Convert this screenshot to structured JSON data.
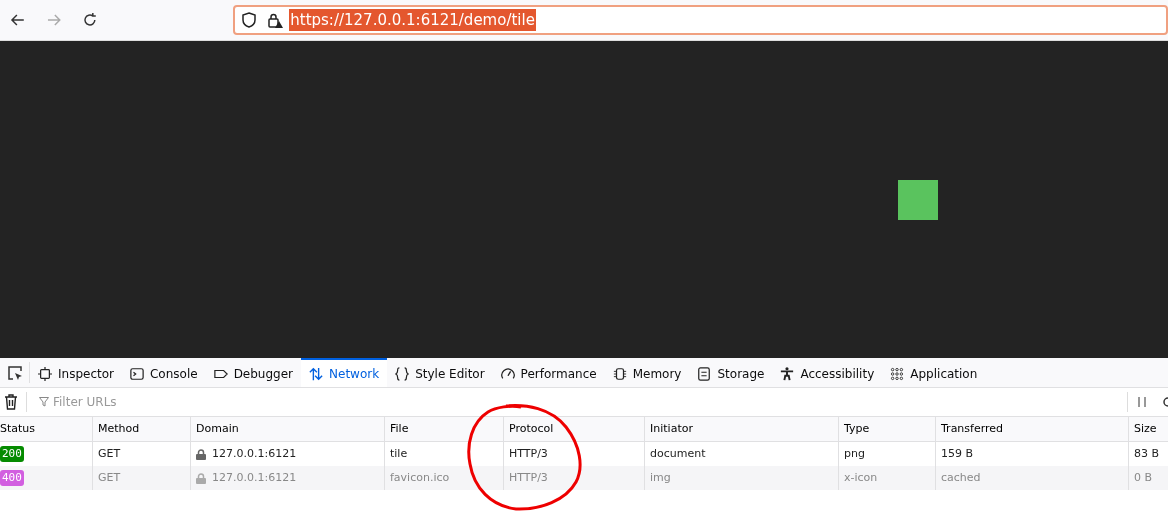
{
  "browser": {
    "url": "https://127.0.0.1:6121/demo/tile",
    "url_selected": true
  },
  "devtools": {
    "tabs": [
      {
        "label": "Inspector",
        "selected": false
      },
      {
        "label": "Console",
        "selected": false
      },
      {
        "label": "Debugger",
        "selected": false
      },
      {
        "label": "Network",
        "selected": true
      },
      {
        "label": "Style Editor",
        "selected": false
      },
      {
        "label": "Performance",
        "selected": false
      },
      {
        "label": "Memory",
        "selected": false
      },
      {
        "label": "Storage",
        "selected": false
      },
      {
        "label": "Accessibility",
        "selected": false
      },
      {
        "label": "Application",
        "selected": false
      }
    ],
    "filter": {
      "placeholder": "Filter URLs"
    },
    "table": {
      "columns": [
        "Status",
        "Method",
        "Domain",
        "File",
        "Protocol",
        "Initiator",
        "Type",
        "Transferred",
        "Size"
      ],
      "rows": [
        {
          "status": "200",
          "color": "#058b00",
          "method": "GET",
          "domain": "127.0.0.1:6121",
          "file": "tile",
          "protocol": "HTTP/3",
          "initiator": "document",
          "type": "png",
          "transferred": "159 B",
          "size": "83 B",
          "cached": false
        },
        {
          "status": "400",
          "color": "#d25fe0",
          "method": "GET",
          "domain": "127.0.0.1:6121",
          "file": "favicon.ico",
          "protocol": "HTTP/3",
          "initiator": "img",
          "type": "x-icon",
          "transferred": "cached",
          "size": "0 B",
          "cached": true
        }
      ]
    }
  }
}
